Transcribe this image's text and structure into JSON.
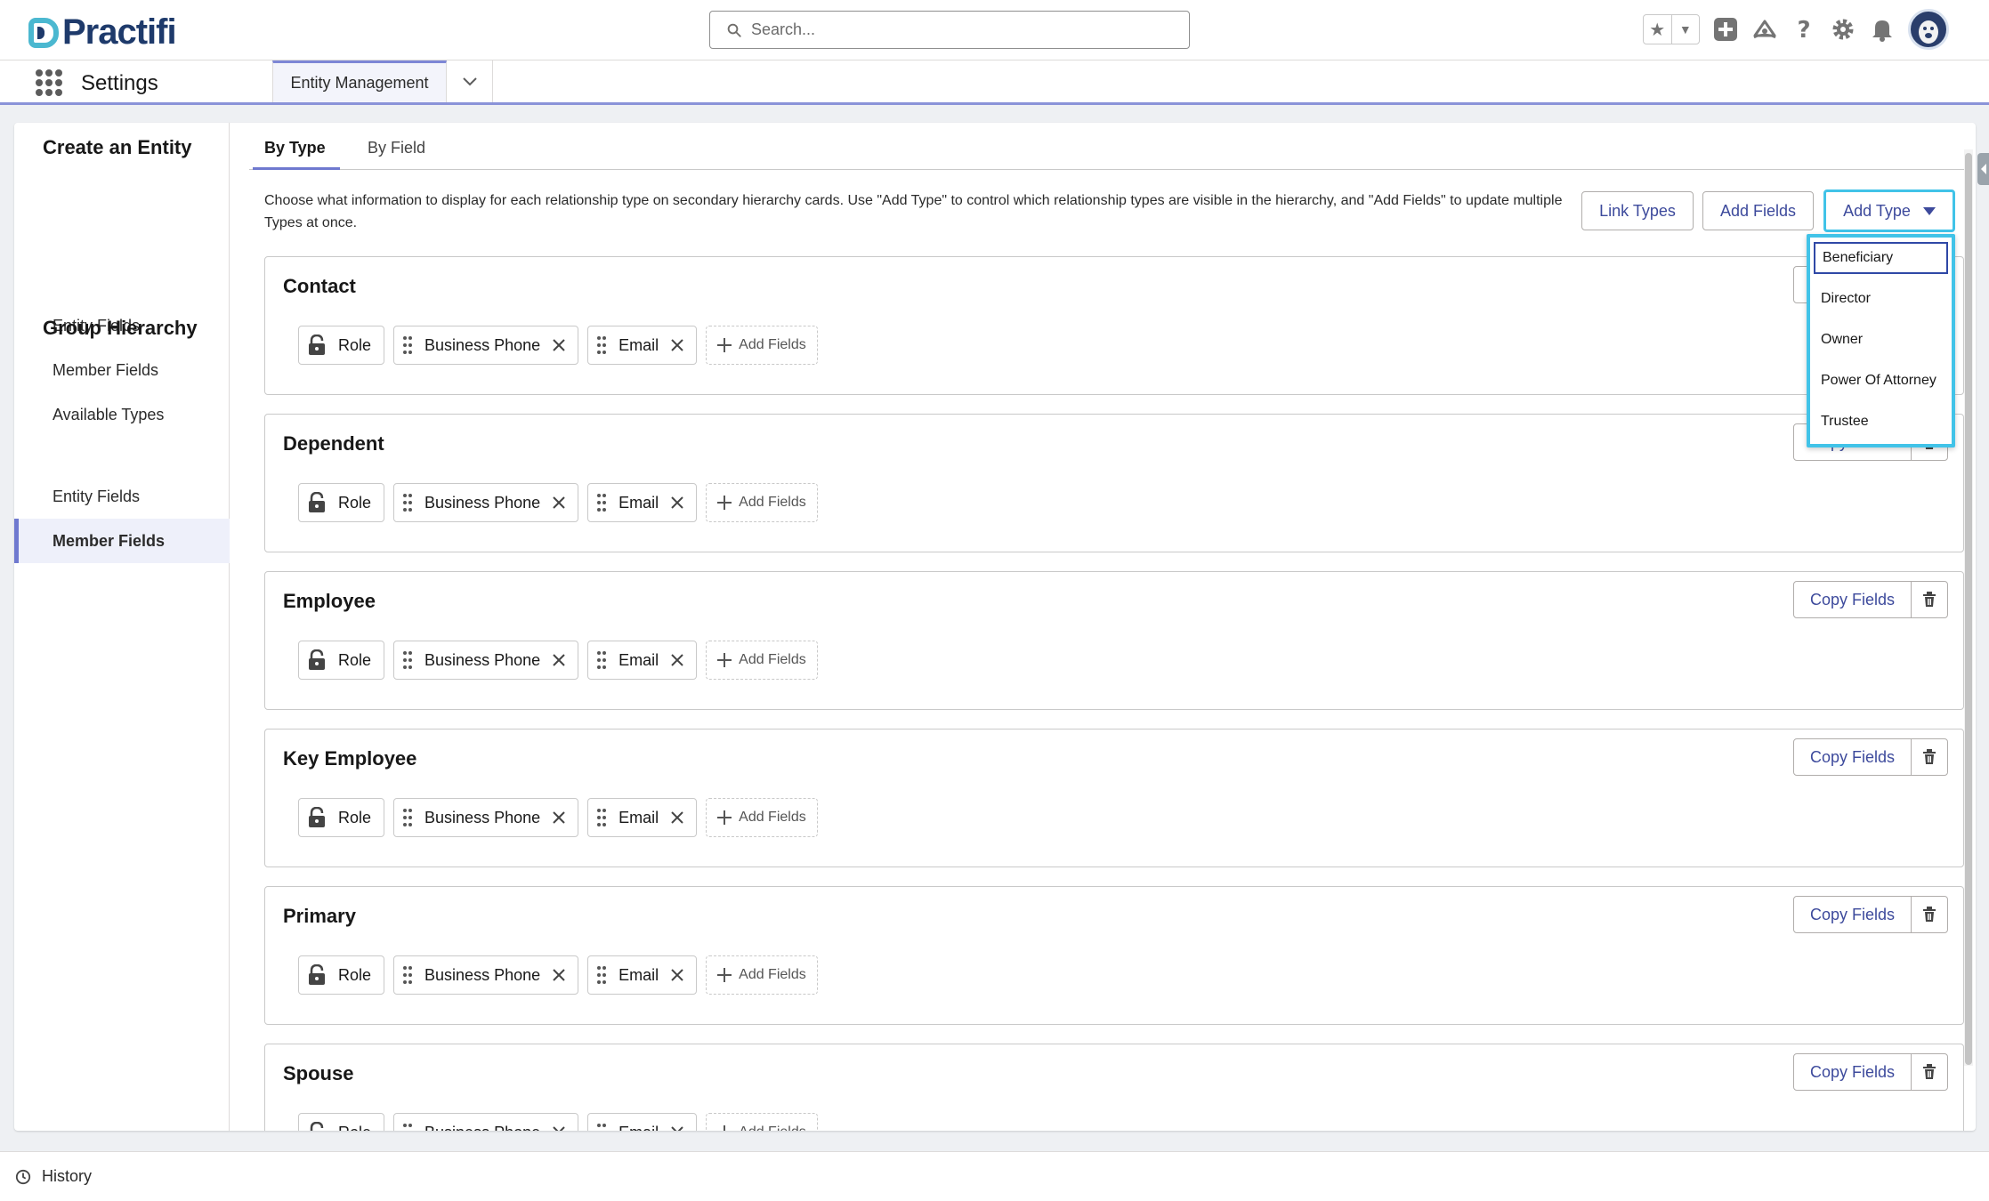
{
  "brand": {
    "name": "Practifi"
  },
  "search": {
    "placeholder": "Search..."
  },
  "nav": {
    "app_name": "Settings",
    "active_tab": "Entity Management"
  },
  "sidebar": {
    "sections": [
      {
        "title": "Create an Entity",
        "items": [
          "Entity Fields",
          "Member Fields",
          "Available Types"
        ]
      },
      {
        "title": "Group Hierarchy",
        "items": [
          "Entity Fields",
          "Member Fields"
        ]
      }
    ],
    "active_item": "Member Fields"
  },
  "tabs": [
    "By Type",
    "By Field"
  ],
  "active_tab": "By Type",
  "description": "Choose what information to display for each relationship type on secondary hierarchy cards. Use \"Add Type\" to control which relationship types are visible in the hierarchy, and \"Add Fields\" to update multiple Types at once.",
  "toolbar": {
    "link_types": "Link Types",
    "add_fields": "Add Fields",
    "add_type": "Add Type"
  },
  "dropdown": {
    "options": [
      "Beneficiary",
      "Director",
      "Owner",
      "Power Of Attorney",
      "Trustee"
    ],
    "focused": "Beneficiary"
  },
  "card_labels": {
    "copy_fields": "Copy Fields",
    "add_fields": "Add Fields"
  },
  "fields": [
    "Role",
    "Business Phone",
    "Email"
  ],
  "types": [
    "Contact",
    "Dependent",
    "Employee",
    "Key Employee",
    "Primary",
    "Spouse"
  ],
  "footer": {
    "history": "History"
  },
  "colors": {
    "brand_navy": "#1e3a6b",
    "brand_teal": "#4bb8d0",
    "accent": "#6f79cf",
    "link": "#3d4a9c",
    "focus_ring": "#41c3e8"
  }
}
